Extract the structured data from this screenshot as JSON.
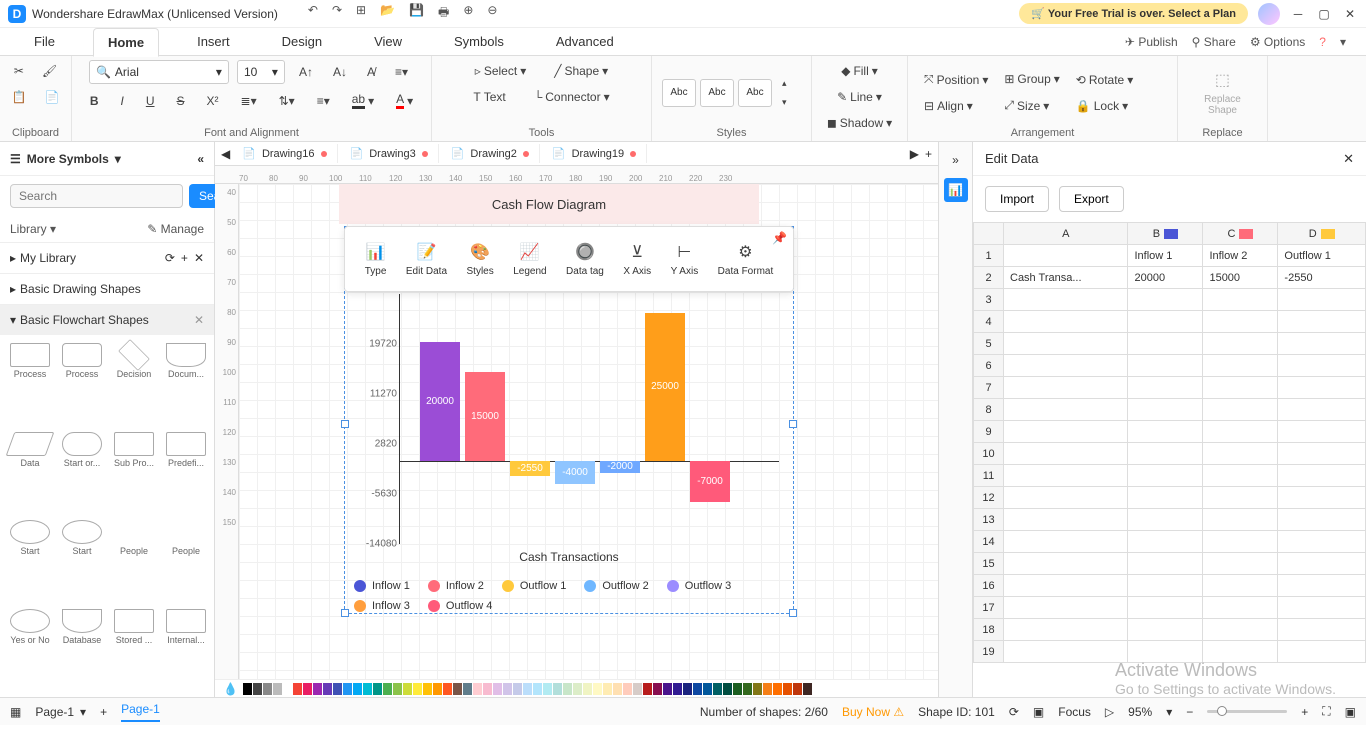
{
  "app": {
    "title": "Wondershare EdrawMax (Unlicensed Version)",
    "trial_msg": "Your Free Trial is over. Select a Plan"
  },
  "menu": {
    "file": "File",
    "home": "Home",
    "insert": "Insert",
    "design": "Design",
    "view": "View",
    "symbols": "Symbols",
    "advanced": "Advanced",
    "publish": "Publish",
    "share": "Share",
    "options": "Options"
  },
  "ribbon": {
    "clipboard": "Clipboard",
    "font_align": "Font and Alignment",
    "font": "Arial",
    "size": "10",
    "select": "Select",
    "shape": "Shape",
    "text": "Text",
    "connector": "Connector",
    "tools": "Tools",
    "abc": "Abc",
    "styles": "Styles",
    "fill": "Fill",
    "line": "Line",
    "shadow": "Shadow",
    "position": "Position",
    "align": "Align",
    "group": "Group",
    "size_lbl": "Size",
    "rotate": "Rotate",
    "lock": "Lock",
    "arrangement": "Arrangement",
    "replace_shape": "Replace\nShape",
    "replace": "Replace"
  },
  "leftpanel": {
    "more_symbols": "More Symbols",
    "search_ph": "Search",
    "search_btn": "Search",
    "library": "Library",
    "manage": "Manage",
    "my_library": "My Library",
    "basic_drawing": "Basic Drawing Shapes",
    "basic_flowchart": "Basic Flowchart Shapes",
    "shapes": [
      "Process",
      "Process",
      "Decision",
      "Docum...",
      "Data",
      "Start or...",
      "Sub Pro...",
      "Predefi...",
      "Start",
      "Start",
      "People",
      "People",
      "Yes or No",
      "Database",
      "Stored ...",
      "Internal..."
    ]
  },
  "tabs": {
    "t1": "Drawing16",
    "t2": "Drawing3",
    "t3": "Drawing2",
    "t4": "Drawing19"
  },
  "ruler_h": [
    "70",
    "80",
    "90",
    "100",
    "110",
    "120",
    "130",
    "140",
    "150",
    "160",
    "170",
    "180",
    "190",
    "200",
    "210",
    "220",
    "230"
  ],
  "ruler_v": [
    "40",
    "50",
    "60",
    "70",
    "80",
    "90",
    "100",
    "110",
    "120",
    "130",
    "140",
    "150"
  ],
  "float_tb": {
    "type": "Type",
    "edit": "Edit Data",
    "styles": "Styles",
    "legend": "Legend",
    "datatag": "Data tag",
    "xaxis": "X Axis",
    "yaxis": "Y Axis",
    "format": "Data Format"
  },
  "chart_data": {
    "type": "bar",
    "title": "Cash Flow Diagram",
    "xlabel": "Cash Transactions",
    "y_ticks": [
      -14080,
      -5630,
      2820,
      11270,
      19720
    ],
    "ylim": [
      -14080,
      28170
    ],
    "series": [
      {
        "name": "Inflow 1",
        "color": "#4a55d6",
        "value": null
      },
      {
        "name": "Inflow 2",
        "color": "#ff6b7a",
        "value": null
      },
      {
        "name": "Outflow 1",
        "color": "#ffc93c",
        "value": null
      },
      {
        "name": "Outflow 2",
        "color": "#6fb7ff",
        "value": null
      },
      {
        "name": "Outflow 3",
        "color": "#9b8cff",
        "value": null
      },
      {
        "name": "Inflow 3",
        "color": "#ff9e3d",
        "value": null
      },
      {
        "name": "Outflow 4",
        "color": "#ff5a7a",
        "value": null
      }
    ],
    "bars": [
      {
        "label": "20000",
        "value": 20000,
        "color": "#9b4dd6"
      },
      {
        "label": "15000",
        "value": 15000,
        "color": "#ff6b7a"
      },
      {
        "label": "-2550",
        "value": -2550,
        "color": "#ffc93c"
      },
      {
        "label": "-4000",
        "value": -4000,
        "color": "#8fc5ff"
      },
      {
        "label": "-2000",
        "value": -2000,
        "color": "#6fa8ff"
      },
      {
        "label": "25000",
        "value": 25000,
        "color": "#ff9e1a"
      },
      {
        "label": "-7000",
        "value": -7000,
        "color": "#ff5a7a"
      }
    ]
  },
  "editdata": {
    "title": "Edit Data",
    "import": "Import",
    "export": "Export",
    "cols": [
      "A",
      "B",
      "C",
      "D"
    ],
    "col_colors": [
      "",
      "#4a55d6",
      "#ff6b7a",
      "#ffc93c"
    ],
    "row1": [
      "",
      "Inflow 1",
      "Inflow 2",
      "Outflow 1"
    ],
    "row2": [
      "Cash Transa...",
      "20000",
      "15000",
      "-2550"
    ],
    "max_row": 19
  },
  "status": {
    "page": "Page-1",
    "page_active": "Page-1",
    "shapes": "Number of shapes: 2/60",
    "buynow": "Buy Now",
    "shapeid": "Shape ID: 101",
    "focus": "Focus",
    "zoom": "95%"
  },
  "watermark": {
    "l1": "Activate Windows",
    "l2": "Go to Settings to activate Windows."
  },
  "colors": [
    "#000",
    "#444",
    "#888",
    "#bbb",
    "#fff",
    "#f44336",
    "#e91e63",
    "#9c27b0",
    "#673ab7",
    "#3f51b5",
    "#2196f3",
    "#03a9f4",
    "#00bcd4",
    "#009688",
    "#4caf50",
    "#8bc34a",
    "#cddc39",
    "#ffeb3b",
    "#ffc107",
    "#ff9800",
    "#ff5722",
    "#795548",
    "#607d8b",
    "#ffcdd2",
    "#f8bbd0",
    "#e1bee7",
    "#d1c4e9",
    "#c5cae9",
    "#bbdefb",
    "#b3e5fc",
    "#b2ebf2",
    "#b2dfdb",
    "#c8e6c9",
    "#dcedc8",
    "#f0f4c3",
    "#fff9c4",
    "#ffecb3",
    "#ffe0b2",
    "#ffccbc",
    "#d7ccc8",
    "#b71c1c",
    "#880e4f",
    "#4a148c",
    "#311b92",
    "#1a237e",
    "#0d47a1",
    "#01579b",
    "#006064",
    "#004d40",
    "#1b5e20",
    "#33691e",
    "#827717",
    "#f57f17",
    "#ff6f00",
    "#e65100",
    "#bf360c",
    "#3e2723"
  ]
}
